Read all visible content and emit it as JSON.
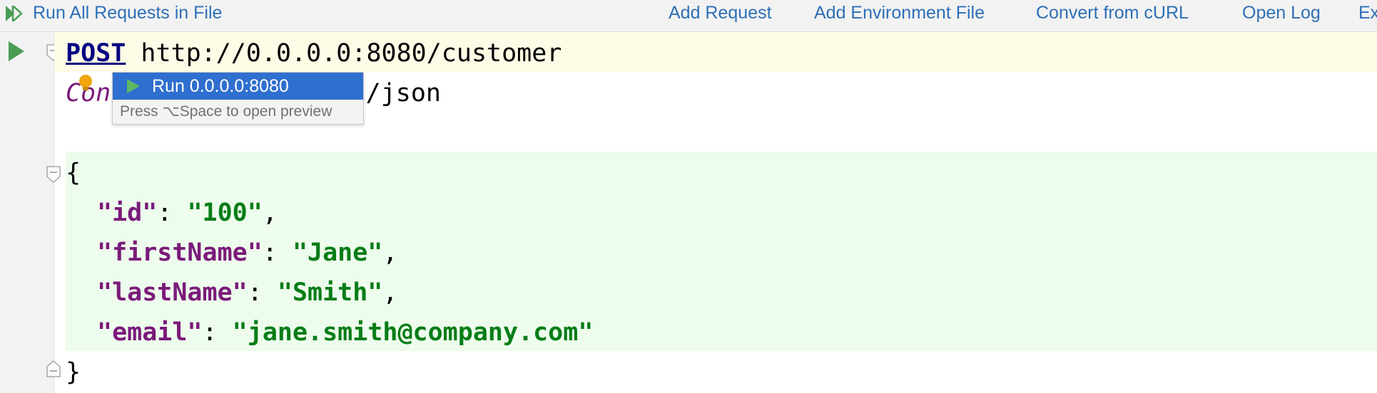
{
  "toolbar": {
    "run_all_label": "Run All Requests in File",
    "add_request_label": "Add Request",
    "add_env_label": "Add Environment File",
    "convert_label": "Convert from cURL",
    "open_log_label": "Open Log",
    "truncated_label": "Ex"
  },
  "editor": {
    "method": "POST",
    "url": "http://0.0.0.0:8080/customer",
    "header_name_visible": "Con",
    "header_value_visible": "cation/json",
    "open_brace": "{",
    "close_brace": "}",
    "body": [
      {
        "key": "\"id\"",
        "value": "\"100\"",
        "comma": ","
      },
      {
        "key": "\"firstName\"",
        "value": "\"Jane\"",
        "comma": ","
      },
      {
        "key": "\"lastName\"",
        "value": "\"Smith\"",
        "comma": ","
      },
      {
        "key": "\"email\"",
        "value": "\"jane.smith@company.com\"",
        "comma": ""
      }
    ],
    "colon": ": "
  },
  "popup": {
    "run_label": "Run 0.0.0.0:8080",
    "hint": "Press ⌥Space to open preview"
  },
  "colors": {
    "accent": "#2d6fb7",
    "run_green": "#499c54",
    "selection": "#2f6fcf",
    "json_bg": "#edfcec",
    "current_line": "#fefbe6"
  },
  "icons": {
    "toolbar_run": "run-all-icon",
    "gutter_run": "run-icon",
    "bulb": "intention-bulb-icon",
    "popup_run": "run-icon",
    "fold": "fold-marker-icon"
  }
}
